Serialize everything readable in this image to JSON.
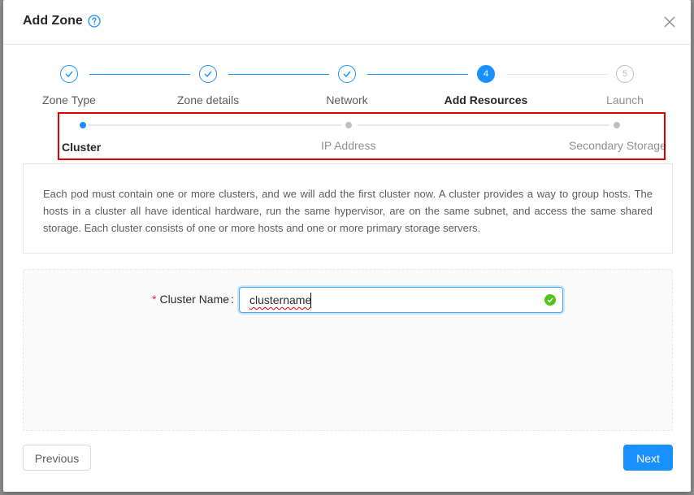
{
  "modal": {
    "title": "Add Zone",
    "help_icon": "question-circle-icon",
    "close_icon": "close-icon"
  },
  "steps": [
    {
      "label": "Zone Type",
      "status": "done",
      "icon": "check-icon"
    },
    {
      "label": "Zone details",
      "status": "done",
      "icon": "check-icon"
    },
    {
      "label": "Network",
      "status": "done",
      "icon": "check-icon"
    },
    {
      "label": "Add Resources",
      "status": "active",
      "number": "4"
    },
    {
      "label": "Launch",
      "status": "wait",
      "number": "5"
    }
  ],
  "sub_steps": [
    {
      "label": "Cluster",
      "status": "active"
    },
    {
      "label": "IP Address",
      "status": "wait"
    },
    {
      "label": "Secondary Storage",
      "status": "wait"
    }
  ],
  "description": "Each pod must contain one or more clusters, and we will add the first cluster now. A cluster provides a way to group hosts. The hosts in a cluster all have identical hardware, run the same hypervisor, are on the same subnet, and access the same shared storage. Each cluster consists of one or more hosts and one or more primary storage servers.",
  "form": {
    "cluster_name_label": "Cluster Name",
    "required_mark": "*",
    "label_colon": ":",
    "cluster_name_value": "clustername",
    "valid_icon": "check-circle-icon"
  },
  "footer": {
    "previous_label": "Previous",
    "next_label": "Next"
  },
  "colors": {
    "primary": "#1890ff",
    "highlight": "#e00000",
    "success": "#52c41a"
  }
}
